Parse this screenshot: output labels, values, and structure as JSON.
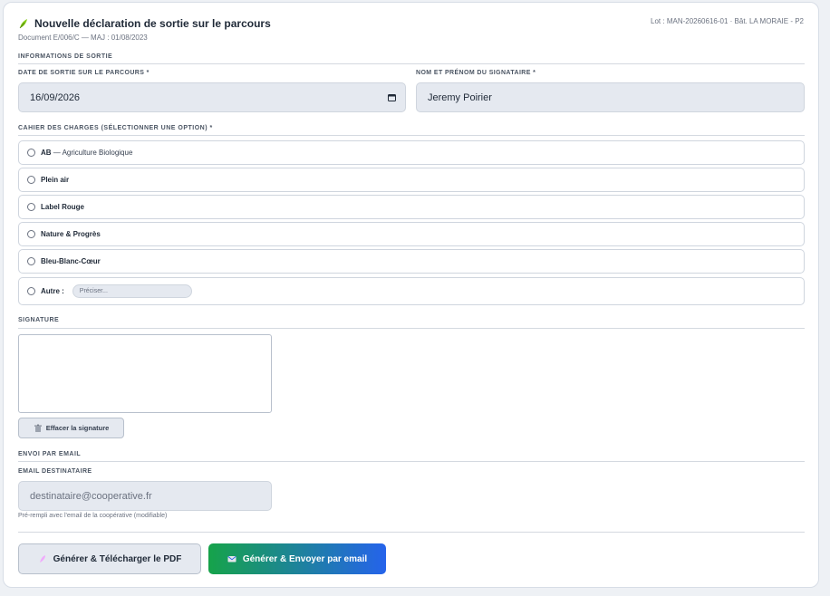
{
  "header": {
    "title": "Nouvelle déclaration de sortie sur le parcours",
    "subtitle": "Document E/006/C — MAJ : 01/08/2023",
    "lot": "Lot : MAN-20260616-01 · Bât. LA MORAIE - P2"
  },
  "sections": {
    "info": "INFORMATIONS DE SORTIE",
    "cahier": "CAHIER DES CHARGES (SÉLECTIONNER UNE OPTION) *",
    "signature": "SIGNATURE",
    "email": "ENVOI PAR EMAIL"
  },
  "fields": {
    "date_label": "DATE DE SORTIE SUR LE PARCOURS *",
    "date_value": "16/09/2026",
    "signer_label": "NOM ET PRÉNOM DU SIGNATAIRE *",
    "signer_value": "Jeremy Poirier",
    "email_label": "EMAIL DESTINATAIRE",
    "email_placeholder": "destinataire@cooperative.fr",
    "email_hint": "Pré-rempli avec l'email de la coopérative (modifiable)"
  },
  "options": [
    {
      "bold": "AB",
      "rest": " — Agriculture Biologique"
    },
    {
      "bold": "Plein air",
      "rest": ""
    },
    {
      "bold": "Label Rouge",
      "rest": ""
    },
    {
      "bold": "Nature & Progrès",
      "rest": ""
    },
    {
      "bold": "Bleu-Blanc-Cœur",
      "rest": ""
    }
  ],
  "autre": {
    "label": "Autre :",
    "placeholder": "Préciser..."
  },
  "buttons": {
    "clear_signature": "Effacer la signature",
    "pdf": "Générer & Télécharger le PDF",
    "email": "Générer & Envoyer par email"
  },
  "colors": {
    "accent_green": "#16a34a",
    "accent_blue": "#2563eb"
  },
  "icons": {
    "title": "leaf-icon",
    "clear": "trash-icon",
    "pdf": "feather-pen-icon",
    "email": "envelope-icon",
    "date": "calendar-icon"
  }
}
